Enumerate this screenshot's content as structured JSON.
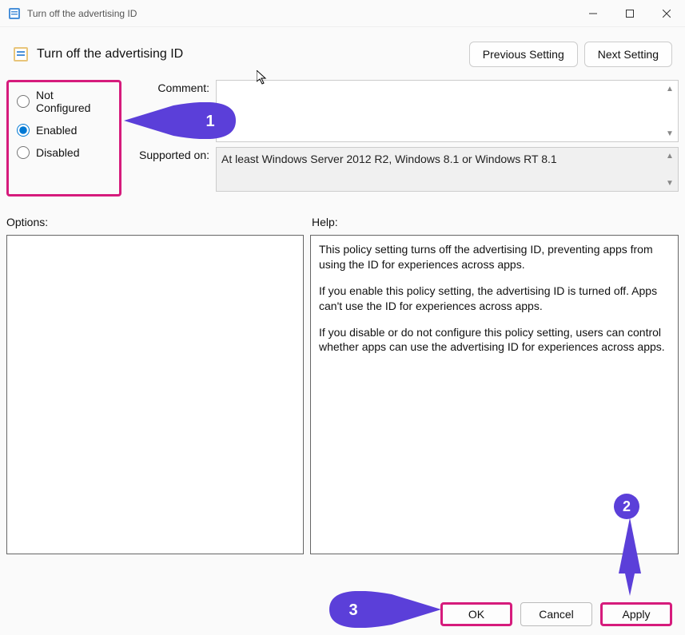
{
  "window": {
    "title": "Turn off the advertising ID"
  },
  "header": {
    "title": "Turn off the advertising ID",
    "prev": "Previous Setting",
    "next": "Next Setting"
  },
  "radios": {
    "not_configured": "Not Configured",
    "enabled": "Enabled",
    "disabled": "Disabled",
    "selected": "enabled"
  },
  "fields": {
    "comment_label": "Comment:",
    "comment_value": "",
    "supported_label": "Supported on:",
    "supported_value": "At least Windows Server 2012 R2, Windows 8.1 or Windows RT 8.1"
  },
  "sections": {
    "options": "Options:",
    "help": "Help:"
  },
  "help": {
    "p1": "This policy setting turns off the advertising ID, preventing apps from using the ID for experiences across apps.",
    "p2": "If you enable this policy setting, the advertising ID is turned off. Apps can't use the ID for experiences across apps.",
    "p3": "If you disable or do not configure this policy setting, users can control whether apps can use the advertising ID for experiences across apps."
  },
  "buttons": {
    "ok": "OK",
    "cancel": "Cancel",
    "apply": "Apply"
  },
  "callouts": {
    "one": "1",
    "two": "2",
    "three": "3"
  }
}
